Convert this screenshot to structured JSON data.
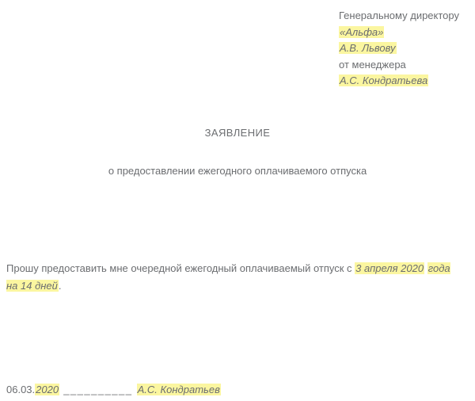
{
  "recipient": {
    "line1": "Генеральному директору",
    "company": "«Альфа»",
    "director": "А.В. Львову",
    "from_label": "от менеджера",
    "from_name": "А.С. Кондратьева"
  },
  "title": "ЗАЯВЛЕНИЕ",
  "subtitle": "о предоставлении ежегодного оплачиваемого отпуска",
  "body": {
    "prefix": " Прошу предоставить мне очередной ежегодный оплачиваемый отпуск с ",
    "highlight1": "3 апреля 2020",
    "middle": " ",
    "highlight2": "года на 14 дней",
    "suffix": "."
  },
  "footer": {
    "date_prefix": "06.03.",
    "date_year": "2020",
    "sig_line": "  __________  ",
    "signer": "А.С. Кондратьев"
  }
}
